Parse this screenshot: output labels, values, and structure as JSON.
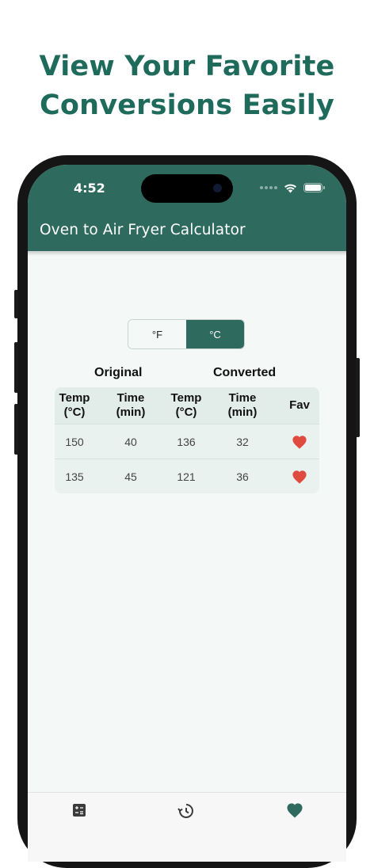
{
  "promo": {
    "line1": "View Your Favorite",
    "line2": "Conversions Easily"
  },
  "status_bar": {
    "time": "4:52"
  },
  "app_bar": {
    "title": "Oven to Air Fryer Calculator"
  },
  "unit_toggle": {
    "options": [
      "°F",
      "°C"
    ],
    "selected": "°C"
  },
  "table": {
    "group_headers": {
      "original": "Original",
      "converted": "Converted"
    },
    "columns": [
      {
        "line1": "Temp",
        "line2": "(°C)"
      },
      {
        "line1": "Time",
        "line2": "(min)"
      },
      {
        "line1": "Temp",
        "line2": "(°C)"
      },
      {
        "line1": "Time",
        "line2": "(min)"
      },
      {
        "line1": "Fav",
        "line2": ""
      }
    ],
    "rows": [
      {
        "orig_temp": "150",
        "orig_time": "40",
        "conv_temp": "136",
        "conv_time": "32",
        "favorite": true
      },
      {
        "orig_temp": "135",
        "orig_time": "45",
        "conv_temp": "121",
        "conv_time": "36",
        "favorite": true
      }
    ]
  },
  "bottom_nav": {
    "items": [
      {
        "icon": "calculator-icon"
      },
      {
        "icon": "history-icon"
      },
      {
        "icon": "heart-icon",
        "active": true
      }
    ]
  },
  "colors": {
    "brand_green": "#2e6b5e",
    "headline_green": "#1f6b5b",
    "heart_red": "#e04b3f"
  }
}
